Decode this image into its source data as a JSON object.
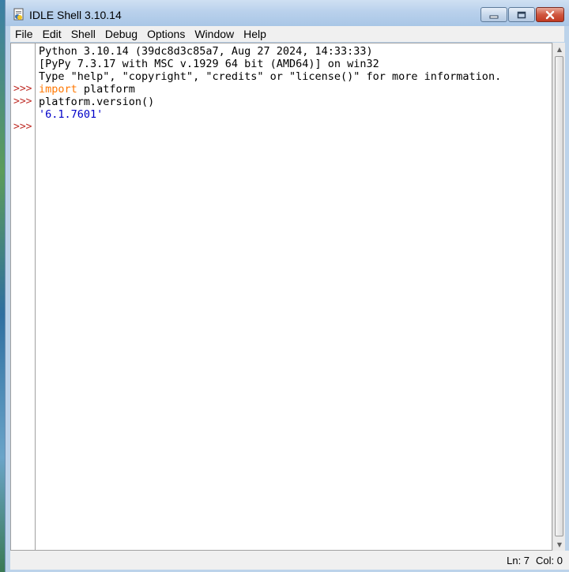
{
  "window": {
    "title": "IDLE Shell 3.10.14",
    "icon": "idle-app-icon"
  },
  "menu": [
    "File",
    "Edit",
    "Shell",
    "Debug",
    "Options",
    "Window",
    "Help"
  ],
  "shell": {
    "prompt": ">>>",
    "lines": {
      "banner1": "Python 3.10.14 (39dc8d3c85a7, Aug 27 2024, 14:33:33)",
      "banner2": "[PyPy 7.3.17 with MSC v.1929 64 bit (AMD64)] on win32",
      "banner3": "Type \"help\", \"copyright\", \"credits\" or \"license()\" for more information.",
      "in1_keyword": "import",
      "in1_rest": " platform",
      "in2": "platform.version()",
      "out2": "'6.1.7601'"
    }
  },
  "status": {
    "ln": "Ln: 7",
    "col": "Col: 0"
  },
  "colors": {
    "keyword": "#ff7700",
    "output": "#0000c8",
    "prompt": "#c0302a"
  }
}
